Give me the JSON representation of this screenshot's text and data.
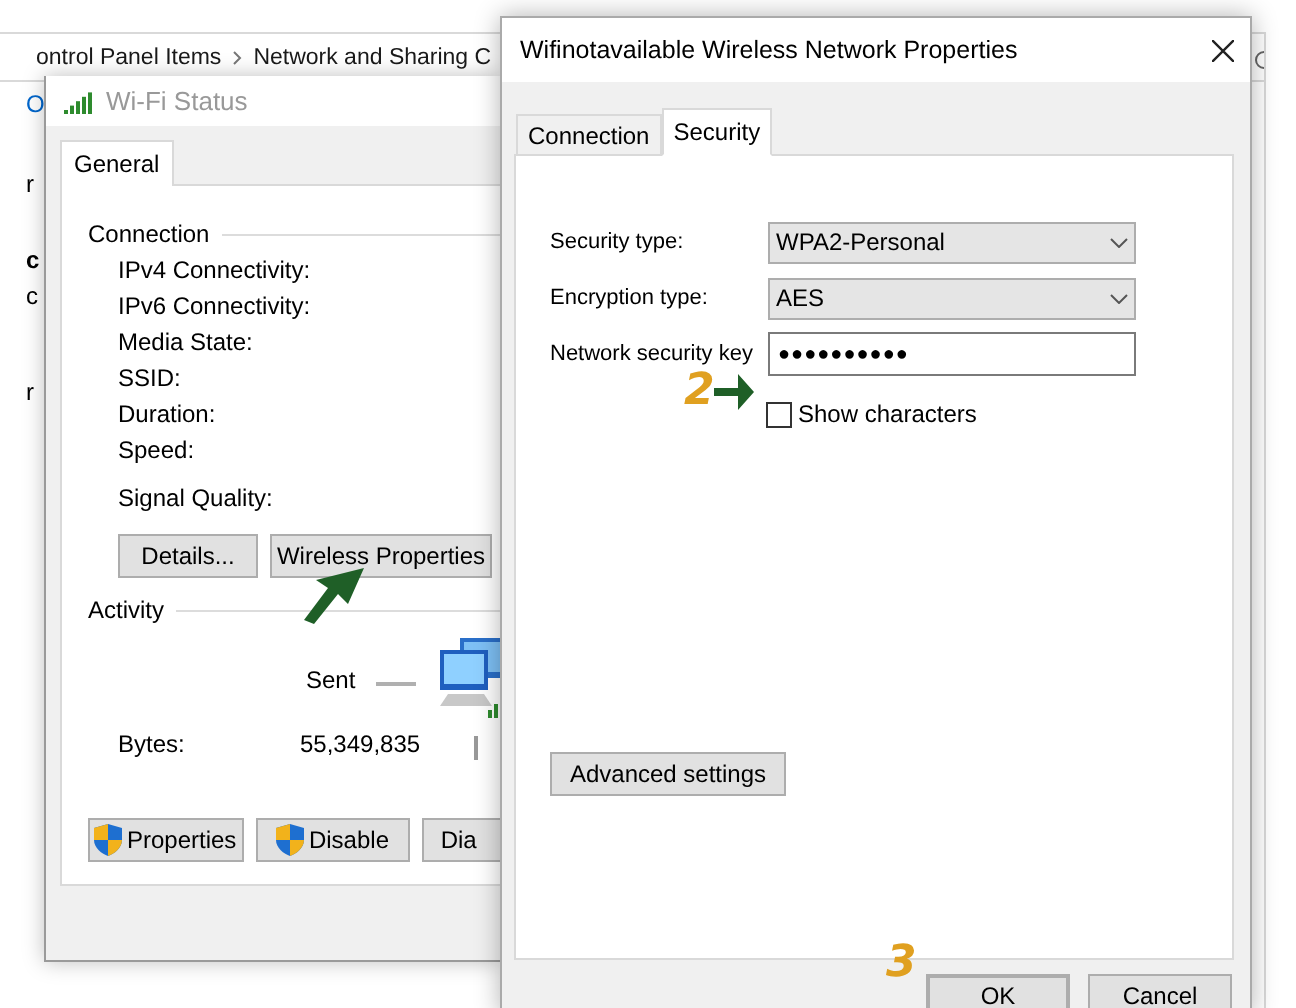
{
  "explorer": {
    "breadcrumb": [
      "ontrol Panel Items",
      "Network and Sharing C"
    ],
    "sidebar_fragments": [
      "O",
      "r",
      "c",
      "c",
      "r"
    ]
  },
  "wifi_status": {
    "title": "Wi-Fi Status",
    "tabs": [
      {
        "label": "General",
        "selected": true
      }
    ],
    "connection": {
      "heading": "Connection",
      "labels": [
        "IPv4 Connectivity:",
        "IPv6 Connectivity:",
        "Media State:",
        "SSID:",
        "Duration:",
        "Speed:"
      ],
      "signal_label": "Signal Quality:"
    },
    "buttons": [
      "Details...",
      "Wireless Properties"
    ],
    "activity": {
      "heading": "Activity",
      "sent_label": "Sent",
      "bytes_label": "Bytes:",
      "bytes_sent": "55,349,835"
    },
    "bottom_buttons": [
      {
        "label": "Properties",
        "shield": true
      },
      {
        "label": "Disable",
        "shield": true
      },
      {
        "label": "Dia",
        "shield": false
      }
    ]
  },
  "properties": {
    "title": "Wifinotavailable Wireless Network Properties",
    "tabs": [
      {
        "label": "Connection",
        "selected": false
      },
      {
        "label": "Security",
        "selected": true
      }
    ],
    "fields": [
      {
        "kind": "select",
        "label": "Security type:",
        "value": "WPA2-Personal"
      },
      {
        "kind": "select",
        "label": "Encryption type:",
        "value": "AES"
      },
      {
        "kind": "password",
        "label": "Network security key",
        "value": "●●●●●●●●●●"
      }
    ],
    "show_characters": {
      "label": "Show characters",
      "checked": false
    },
    "advanced_button": "Advanced settings",
    "ok": "OK",
    "cancel": "Cancel"
  },
  "annotations": [
    {
      "kind": "arrow"
    },
    {
      "kind": "numbered_arrow",
      "label": "2"
    },
    {
      "kind": "number",
      "label": "3"
    }
  ]
}
